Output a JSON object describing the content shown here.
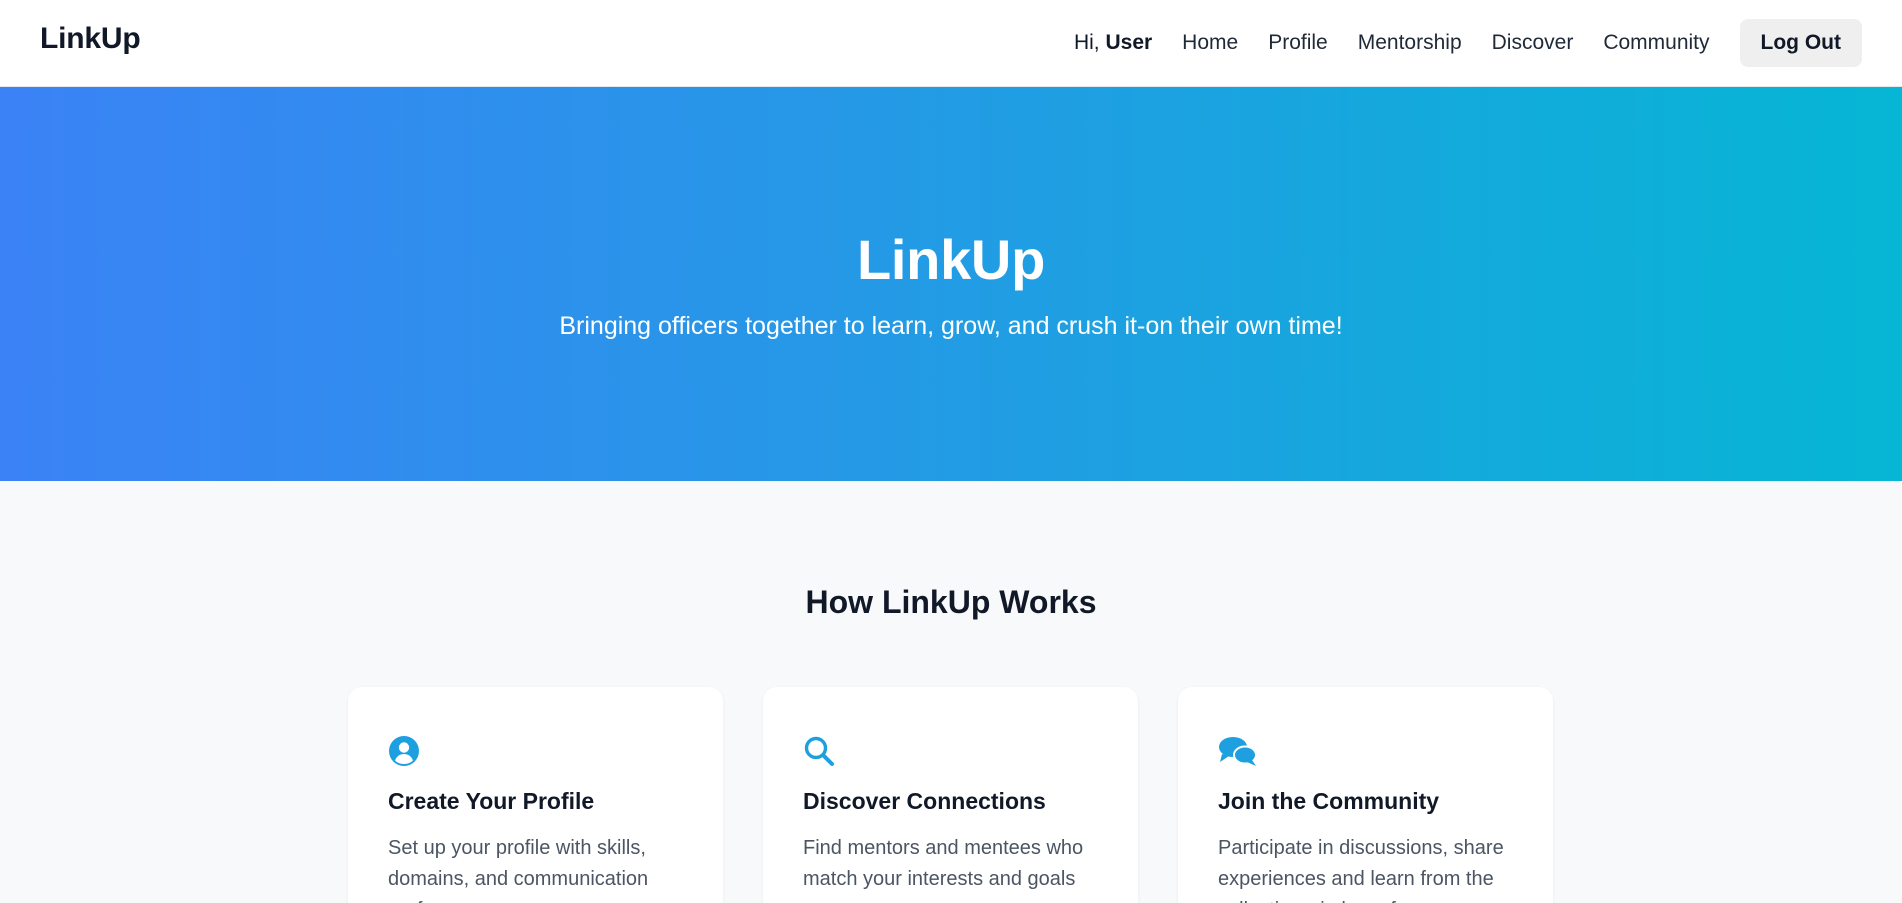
{
  "nav": {
    "brand": "LinkUp",
    "greeting_prefix": "Hi, ",
    "user_name": "User",
    "links": [
      "Home",
      "Profile",
      "Mentorship",
      "Discover",
      "Community"
    ],
    "logout_label": "Log Out"
  },
  "hero": {
    "title": "LinkUp",
    "subtitle": "Bringing officers together to learn, grow, and crush it-on their own time!",
    "gradient_colors": [
      "#3b82f6",
      "#06b6d4"
    ]
  },
  "how_it_works": {
    "title": "How LinkUp Works",
    "accent_color": "#1e9fe0",
    "cards": [
      {
        "icon": "user-circle-icon",
        "title": "Create Your Profile",
        "text": "Set up your profile with skills, domains, and communication preferences"
      },
      {
        "icon": "search-icon",
        "title": "Discover Connections",
        "text": "Find mentors and mentees who match your interests and goals"
      },
      {
        "icon": "comments-icon",
        "title": "Join the Community",
        "text": "Participate in discussions, share experiences and learn from the collective wisdom of peers"
      }
    ]
  }
}
